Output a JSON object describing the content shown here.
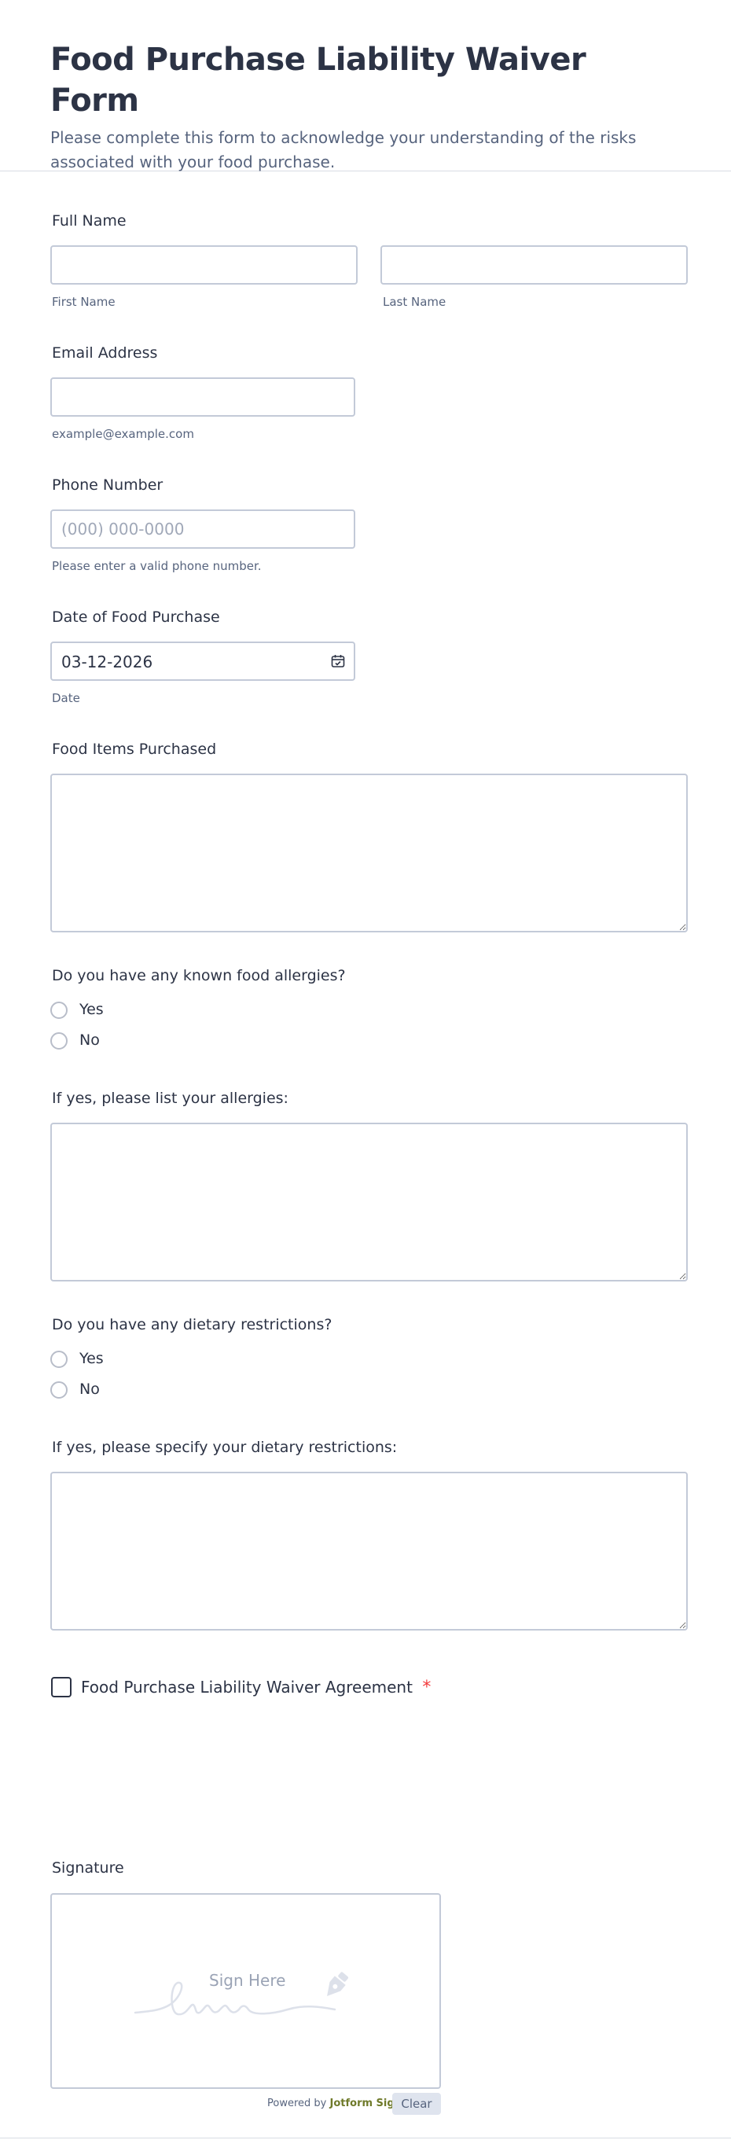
{
  "form": {
    "title": "Food Purchase Liability Waiver Form",
    "subtitle": "Please complete this form to acknowledge your understanding of the risks associated with your food purchase."
  },
  "full_name": {
    "label": "Full Name",
    "first_sublabel": "First Name",
    "last_sublabel": "Last Name",
    "first_value": "",
    "last_value": ""
  },
  "email": {
    "label": "Email Address",
    "value": "",
    "sublabel": "example@example.com"
  },
  "phone": {
    "label": "Phone Number",
    "placeholder": "(000) 000-0000",
    "sublabel": "Please enter a valid phone number."
  },
  "date": {
    "label": "Date of Food Purchase",
    "value": "03-12-2026",
    "sublabel": "Date",
    "icon": "calendar-icon"
  },
  "food_items": {
    "label": "Food Items Purchased",
    "value": ""
  },
  "allergies": {
    "question": "Do you have any known food allergies?",
    "options": [
      "Yes",
      "No"
    ],
    "list_label": "If yes, please list your allergies:"
  },
  "dietary": {
    "question": "Do you have any dietary restrictions?",
    "options": [
      "Yes",
      "No"
    ],
    "specify_label": "If yes, please specify your dietary restrictions:"
  },
  "agreement": {
    "label": "Food Purchase Liability Waiver Agreement",
    "required_mark": "*"
  },
  "signature": {
    "label": "Signature",
    "placeholder": "Sign Here",
    "icon": "pen-nib-icon",
    "powered_by": "Powered by",
    "brand": "Jotform Sign",
    "clear_label": "Clear"
  },
  "colors": {
    "text": "#2c3345",
    "muted": "#57647e",
    "border": "#c3cad8",
    "required": "#f23a3c",
    "brand": "#6f7a2a"
  }
}
